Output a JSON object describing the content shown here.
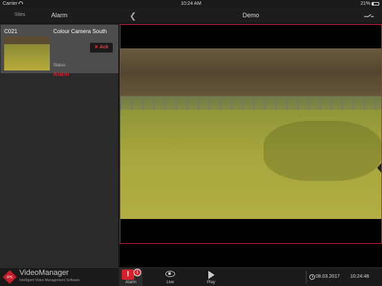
{
  "statusbar": {
    "carrier": "Carrier",
    "time": "10:24 AM",
    "battery": "21%"
  },
  "left_header": {
    "sites_label": "Sites",
    "title": "Alarm"
  },
  "alarm_list": [
    {
      "code": "C021",
      "camera": "Colour Camera South",
      "status_label": "Status:",
      "status_value": "Alarm",
      "ack_label": "Ack"
    }
  ],
  "right_header": {
    "title": "Demo",
    "back_icon": "chevron-left-icon",
    "settings_icon": "toggle-switch-icon"
  },
  "bottom_bar": {
    "brand": "VideoManager",
    "brand_sub": "Intelligent Video Management Software",
    "tabs": [
      {
        "label": "Alarm",
        "icon": "alarm-icon",
        "badge": "1"
      },
      {
        "label": "Live",
        "icon": "eye-icon"
      },
      {
        "label": "Play",
        "icon": "play-icon"
      }
    ],
    "date": "08.03.2017",
    "time": "10:24:48"
  },
  "colors": {
    "accent": "#d4212b",
    "alarm_text": "#e21d2d",
    "video_border": "#d3203a"
  }
}
